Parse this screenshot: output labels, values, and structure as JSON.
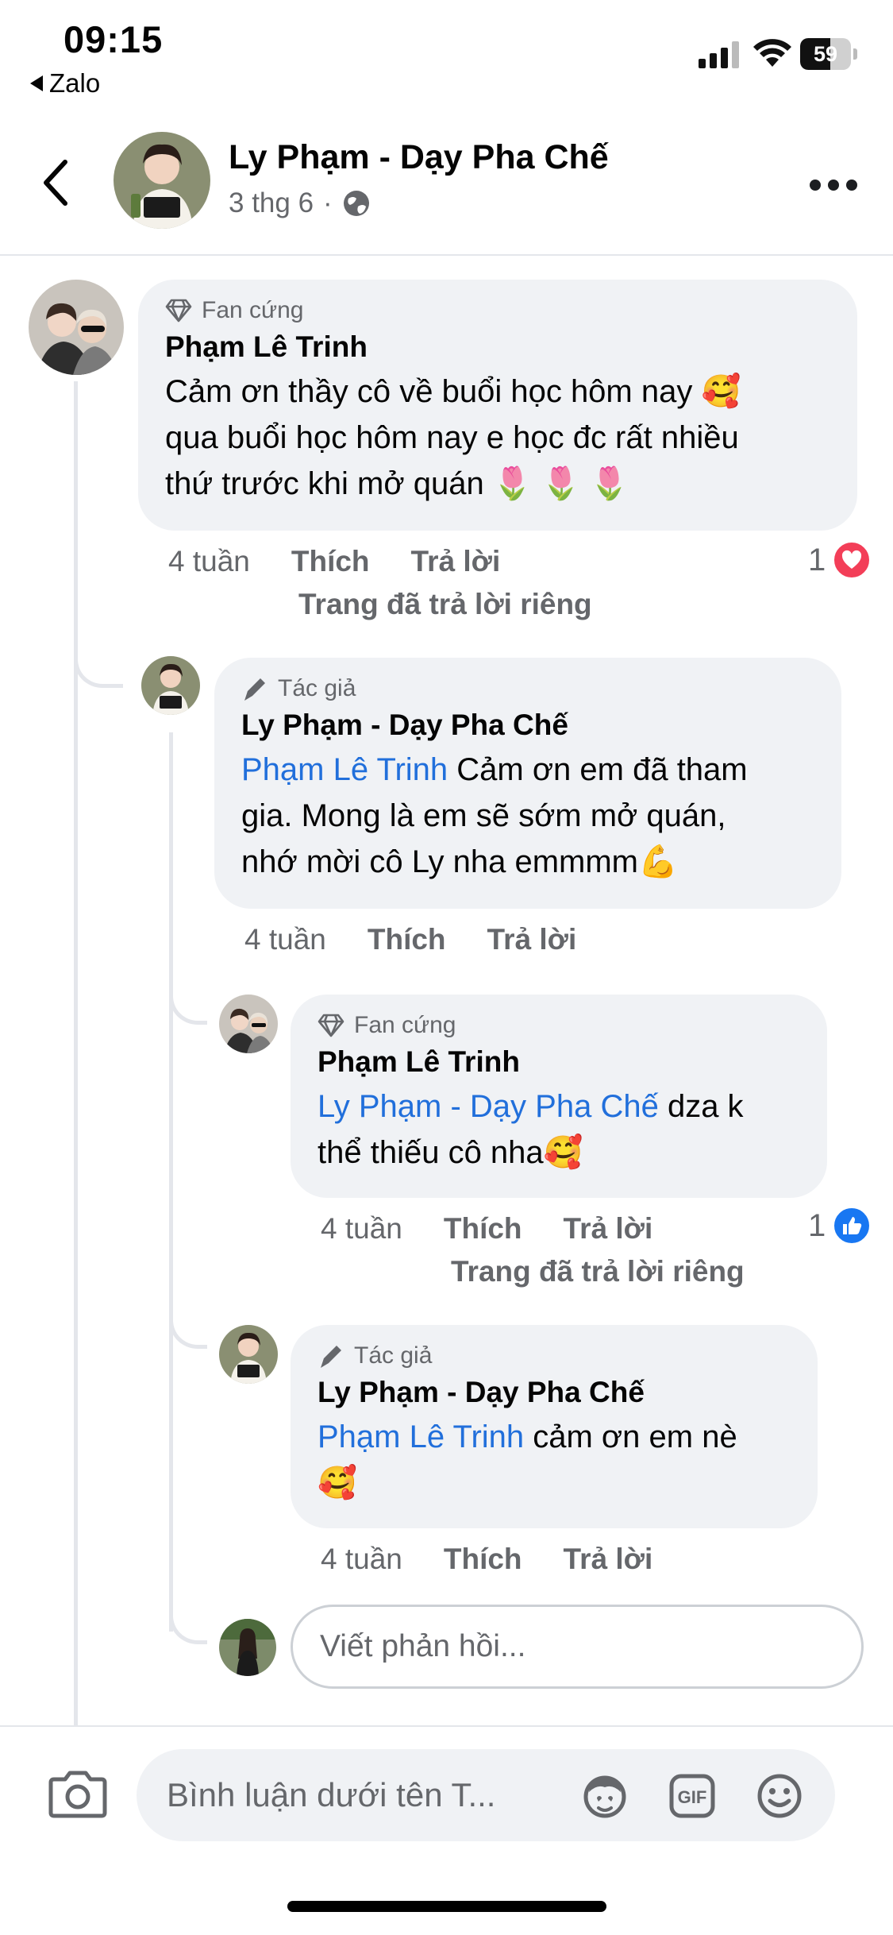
{
  "status_bar": {
    "time": "09:15",
    "back_app": "Zalo",
    "battery_level": 59,
    "battery_text": "59"
  },
  "header": {
    "title": "Ly Phạm - Dạy Pha Chế",
    "date": "3 thg 6",
    "separator": "·"
  },
  "comments": [
    {
      "badge": "Fan cứng",
      "author": "Phạm Lê Trinh",
      "lines": [
        "Cảm ơn thầy cô về buổi học hôm nay 🥰",
        "qua buổi học hôm nay e học đc rất nhiều",
        "thứ trước khi mở quán 🌷 🌷 🌷"
      ],
      "time": "4 tuần",
      "like_label": "Thích",
      "reply_label": "Trả lời",
      "private_reply": "Trang đã trả lời riêng",
      "reaction_count": "1",
      "reaction_type": "love"
    },
    {
      "badge": "Tác giả",
      "author": "Ly Phạm - Dạy Pha Chế",
      "mention": "Phạm Lê Trinh",
      "lines": [
        " Cảm ơn em đã tham",
        "gia. Mong là em sẽ sớm mở quán,",
        "nhớ mời cô Ly nha emmmm💪"
      ],
      "time": "4 tuần",
      "like_label": "Thích",
      "reply_label": "Trả lời"
    },
    {
      "badge": "Fan cứng",
      "author": "Phạm Lê Trinh",
      "mention": "Ly Phạm - Dạy Pha Chế",
      "lines": [
        " dza k",
        "thể thiếu cô nha🥰"
      ],
      "time": "4 tuần",
      "like_label": "Thích",
      "reply_label": "Trả lời",
      "private_reply": "Trang đã trả lời riêng",
      "reaction_count": "1",
      "reaction_type": "like"
    },
    {
      "badge": "Tác giả",
      "author": "Ly Phạm - Dạy Pha Chế",
      "mention": "Phạm Lê Trinh",
      "lines": [
        " cảm ơn em nè",
        "🥰"
      ],
      "time": "4 tuần",
      "like_label": "Thích",
      "reply_label": "Trả lời"
    }
  ],
  "reply_input": {
    "placeholder": "Viết phản hồi..."
  },
  "composer": {
    "placeholder": "Bình luận dưới tên T..."
  },
  "icons": {
    "badge_fan": "diamond-icon",
    "badge_author": "pen-icon",
    "camera": "camera-icon",
    "avatar_sticker": "avatar-sticker-icon",
    "gif": "gif-icon",
    "emoji": "smiley-icon"
  },
  "colors": {
    "mention": "#216fdb",
    "bubble": "#f0f2f5",
    "love": "#f33e58",
    "like": "#1877f2"
  }
}
